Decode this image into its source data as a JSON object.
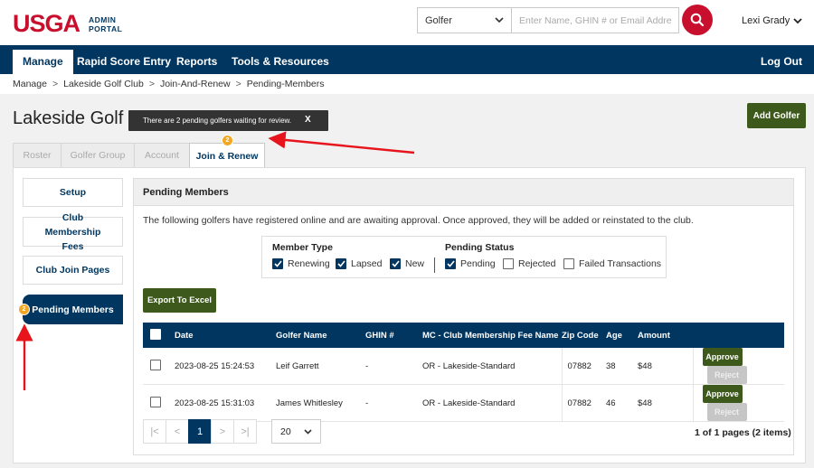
{
  "brand": {
    "logo_main": "USGA",
    "logo_sub_1": "ADMIN",
    "logo_sub_2": "PORTAL",
    "accent": "#c8102e",
    "navy": "#00365f",
    "green": "#3d5a1c"
  },
  "search": {
    "type_value": "Golfer",
    "placeholder": "Enter Name, GHIN # or Email Address"
  },
  "user": {
    "name": "Lexi Grady"
  },
  "nav": {
    "manage": "Manage",
    "rapid": "Rapid Score Entry",
    "reports": "Reports",
    "tools": "Tools & Resources",
    "logout": "Log Out"
  },
  "breadcrumb": [
    "Manage",
    "Lakeside Golf Club",
    "Join-And-Renew",
    "Pending-Members"
  ],
  "page": {
    "title": "Lakeside Golf Club",
    "add_golfer": "Add Golfer"
  },
  "tabs": [
    "Roster",
    "Golfer Group",
    "Account",
    "Join & Renew"
  ],
  "tooltip": {
    "text": "There are 2 pending golfers waiting for review.",
    "close": "X",
    "badge": "2"
  },
  "sidebar": [
    "Setup",
    "Club Membership Fees",
    "Club Join Pages",
    "Pending Members"
  ],
  "sidebar_badge": "2",
  "panel": {
    "title": "Pending Members",
    "description": "The following golfers have registered online and are awaiting approval. Once approved, they will be added or reinstated to the club."
  },
  "filters": {
    "member_type_title": "Member Type",
    "member_type": [
      {
        "label": "Renewing",
        "checked": true
      },
      {
        "label": "Lapsed",
        "checked": true
      },
      {
        "label": "New",
        "checked": true
      }
    ],
    "pending_status_title": "Pending Status",
    "pending_status": [
      {
        "label": "Pending",
        "checked": true
      },
      {
        "label": "Rejected",
        "checked": false
      },
      {
        "label": "Failed Transactions",
        "checked": false
      }
    ]
  },
  "export_label": "Export To Excel",
  "table": {
    "headers": [
      "Date",
      "Golfer Name",
      "GHIN #",
      "MC - Club Membership Fee Name",
      "Zip Code",
      "Age",
      "Amount"
    ],
    "rows": [
      {
        "date": "2023-08-25 15:24:53",
        "name": "Leif Garrett",
        "ghin": "-",
        "fee": "OR - Lakeside-Standard",
        "zip": "07882",
        "age": "38",
        "amount": "$48"
      },
      {
        "date": "2023-08-25 15:31:03",
        "name": "James Whitlesley",
        "ghin": "-",
        "fee": "OR - Lakeside-Standard",
        "zip": "07882",
        "age": "46",
        "amount": "$48"
      }
    ],
    "approve": "Approve",
    "reject": "Reject"
  },
  "pagination": {
    "first": "|<",
    "prev": "<",
    "current": "1",
    "next": ">",
    "last": ">|",
    "page_size": "20",
    "info": "1 of 1 pages (2 items)"
  }
}
